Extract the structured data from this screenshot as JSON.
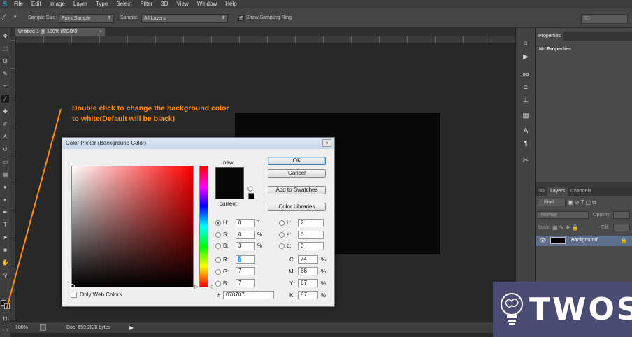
{
  "menubar": {
    "logo": "S",
    "items": [
      "File",
      "Edit",
      "Image",
      "Layer",
      "Type",
      "Select",
      "Filter",
      "3D",
      "View",
      "Window",
      "Help"
    ]
  },
  "options": {
    "sample_size_label": "Sample Size:",
    "sample_size_value": "Point Sample",
    "sample_label": "Sample:",
    "sample_value": "All Layers",
    "ring_label": "Show Sampling Ring",
    "ring_checked": true,
    "workspace_value": "3D"
  },
  "document": {
    "tab_title": "Untitled-1 @ 100% (RGB/8)",
    "background_color": "#080808"
  },
  "annotation": {
    "text_line1": "Double click to change the background color",
    "text_line2": "to white(Default will be black)",
    "color": "#ff8c1a"
  },
  "status": {
    "zoom": "100%",
    "doc_info": "Doc: 659.2K/0 bytes"
  },
  "properties_panel": {
    "tab": "Properties",
    "message": "No Properties"
  },
  "layers_panel": {
    "tabs": [
      "3D",
      "Layers",
      "Channels"
    ],
    "active_tab": "Layers",
    "filter_label": "Kind",
    "blend_mode": "Normal",
    "opacity_label": "Opacity:",
    "lock_label": "Lock:",
    "fill_label": "Fill:",
    "layer_name": "Background"
  },
  "color_picker": {
    "title": "Color Picker (Background Color)",
    "new_label": "new",
    "current_label": "current",
    "buttons": {
      "ok": "OK",
      "cancel": "Cancel",
      "add_swatches": "Add to Swatches",
      "libraries": "Color Libraries"
    },
    "hsb": {
      "h_label": "H:",
      "h": "0",
      "h_unit": "°",
      "s_label": "S:",
      "s": "0",
      "s_unit": "%",
      "b_label": "B:",
      "b": "3",
      "b_unit": "%"
    },
    "rgb": {
      "r_label": "R:",
      "r": "7",
      "g_label": "G:",
      "g": "7",
      "b_label": "B:",
      "b": "7"
    },
    "lab": {
      "l_label": "L:",
      "l": "2",
      "a_label": "a:",
      "a": "0",
      "b_label": "b:",
      "b": "0"
    },
    "cmyk": {
      "c_label": "C:",
      "c": "74",
      "m_label": "M:",
      "m": "68",
      "y_label": "Y:",
      "y": "67",
      "k_label": "K:",
      "k": "87",
      "unit": "%"
    },
    "hex_label": "#",
    "hex": "070707",
    "only_web_label": "Only Web Colors",
    "new_color": "#070707",
    "current_color": "#070707"
  },
  "watermark": {
    "text": "TWOS"
  }
}
